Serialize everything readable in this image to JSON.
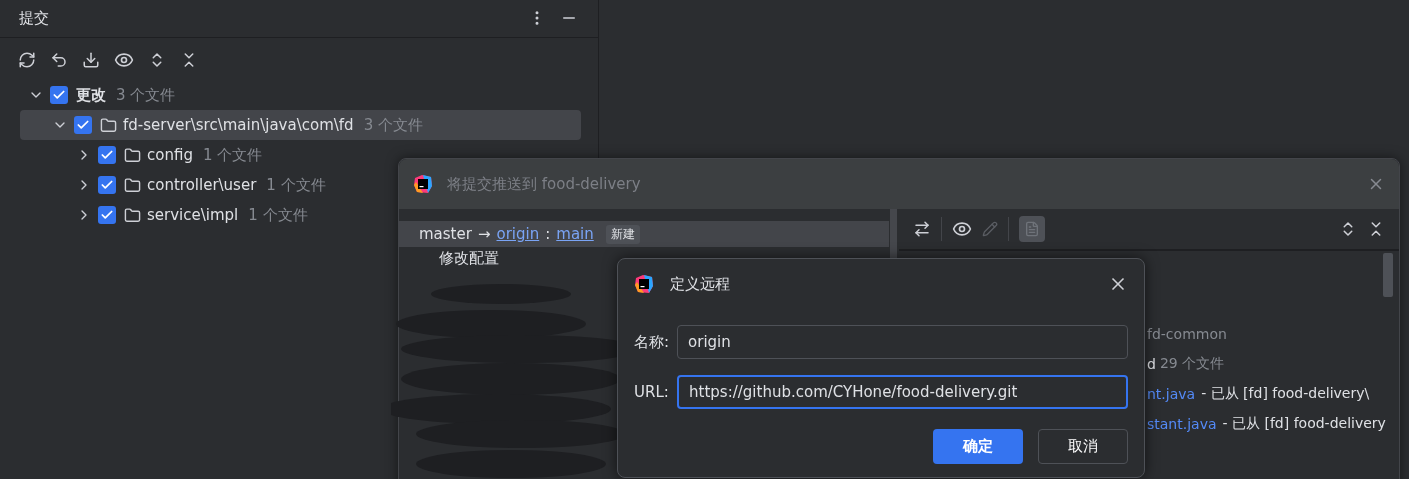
{
  "commit_panel": {
    "title": "提交",
    "tree": [
      {
        "label": "更改",
        "count": "3 个文件",
        "checked": true,
        "expanded": true,
        "selected": false,
        "children": [
          {
            "label": "fd-server\\src\\main\\java\\com\\fd",
            "count": "3 个文件",
            "checked": true,
            "expanded": true,
            "selected": true,
            "children": [
              {
                "label": "config",
                "count": "1 个文件",
                "checked": true,
                "expanded": false,
                "selected": false
              },
              {
                "label": "controller\\user",
                "count": "1 个文件",
                "checked": true,
                "expanded": false,
                "selected": false
              },
              {
                "label": "service\\impl",
                "count": "1 个文件",
                "checked": true,
                "expanded": false,
                "selected": false
              }
            ]
          }
        ]
      }
    ]
  },
  "push_dialog": {
    "title": "将提交推送到 food-delivery",
    "branch": {
      "source": "master",
      "arrow": "→",
      "remote": "origin",
      "separator": ":",
      "target": "main",
      "badge": "新建"
    },
    "commits": [
      "修改配置"
    ],
    "changes": [
      {
        "kind": "folder",
        "name": "fd-common"
      },
      {
        "kind": "folder",
        "name": "d",
        "count": "29 个文件"
      },
      {
        "kind": "file",
        "name": "nt.java",
        "note": "- 已从 [fd] food-delivery\\"
      },
      {
        "kind": "file",
        "name": "stant.java",
        "note": "- 已从 [fd] food-delivery"
      }
    ]
  },
  "remote_dialog": {
    "title": "定义远程",
    "fields": [
      {
        "label": "名称:",
        "value": "origin",
        "focused": false
      },
      {
        "label": "URL:",
        "value": "https://github.com/CYHone/food-delivery.git",
        "focused": true
      }
    ],
    "buttons": [
      {
        "label": "确定",
        "primary": true
      },
      {
        "label": "取消",
        "primary": false
      }
    ]
  }
}
